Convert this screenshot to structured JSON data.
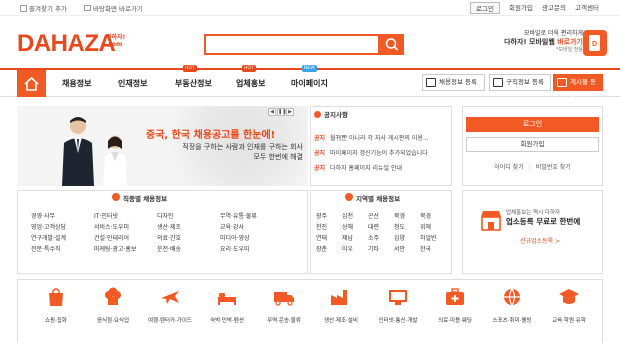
{
  "topbar": {
    "bookmark": "즐겨찾기 추가",
    "desktop": "바탕화면 바로가기",
    "login": "로그인",
    "signup": "회원가입",
    "ad_inquiry": "광고문의",
    "customer_center": "고객센터"
  },
  "header": {
    "logo": "DAHAZA",
    "logo_sub1": "다하자!",
    "logo_sub2": ".com",
    "search_placeholder": "",
    "promo_line1": "모바일로 더욱 편리하게",
    "promo_line2a": "다하자! 모바일웹 ",
    "promo_line2b": "바로가기",
    "promo_line3": "*모바일 전용"
  },
  "nav": {
    "items": [
      {
        "label": "채용정보",
        "badge": ""
      },
      {
        "label": "인재정보",
        "badge": ""
      },
      {
        "label": "부동산정보",
        "badge": "HOT"
      },
      {
        "label": "업체홍보",
        "badge": "HOT"
      },
      {
        "label": "마이페이지",
        "badge": "NEW"
      }
    ],
    "buttons": [
      "채용정보 등록",
      "구직정보 등록",
      "게시물 등록"
    ]
  },
  "banner": {
    "headline": "중국, 한국 채용공고를 한눈에!",
    "sub1": "직장을 구하는 사람과 인재를 구하는 회사",
    "sub2": "모두 한번에 해결"
  },
  "notice": {
    "title": "공지사항",
    "rows": [
      {
        "tag": "공지",
        "text": "월刊뿐 아니라 각 지사 게시판의 이용..."
      },
      {
        "tag": "공지",
        "text": "마이페이지 갱신기능이 추가되었습니다"
      },
      {
        "tag": "공지",
        "text": "다하자 홈페이지 리뉴얼 안내"
      }
    ]
  },
  "login": {
    "login_btn": "로그인",
    "signup_btn": "회원가입",
    "find_id": "아이디 찾기",
    "find_pw": "비밀번호 찾기"
  },
  "job_category": {
    "title": "직종별 채용정보",
    "columns": [
      [
        "경영·사무",
        "영업·고객상담",
        "연구개발·설계",
        "전문·특수직"
      ],
      [
        "IT·인터넷",
        "서비스·도우미",
        "건설·인테리어",
        "마케팅·광고·홍보"
      ],
      [
        "디자인",
        "생산·제조",
        "의료·간호",
        "운전·배송"
      ],
      [
        "무역·유통·물류",
        "교육·강사",
        "미디어·영상",
        "요리·도우미"
      ]
    ]
  },
  "region_category": {
    "title": "지역별 채용정보",
    "columns": [
      [
        "광주",
        "천진",
        "연태",
        "장춘"
      ],
      [
        "심천",
        "상해",
        "제남",
        "이우"
      ],
      [
        "곤산",
        "대련",
        "소주",
        "기타"
      ],
      [
        "북경",
        "청도",
        "심양",
        "서안"
      ],
      [
        "북경",
        "위해",
        "하얼빈",
        "한국"
      ]
    ]
  },
  "ad_box": {
    "line1": "업체홍보는 역시 다하자",
    "line2": "업소등록 무료로 한번에",
    "line3": "신규업소등록 >"
  },
  "bottom_categories": [
    {
      "label": "쇼핑·잡화",
      "icon": "shopping-bag-icon"
    },
    {
      "label": "음식점·요식업",
      "icon": "chef-hat-icon"
    },
    {
      "label": "여행·렌터카·가이드",
      "icon": "airplane-icon"
    },
    {
      "label": "숙박·민박·펜션",
      "icon": "bed-icon"
    },
    {
      "label": "무역·운송·물류",
      "icon": "truck-icon"
    },
    {
      "label": "생산·제조·설비",
      "icon": "factory-icon"
    },
    {
      "label": "인터넷·통신·개발",
      "icon": "monitor-icon"
    },
    {
      "label": "의료·미용·웨딩",
      "icon": "medical-icon"
    },
    {
      "label": "스포츠·취미·웰빙",
      "icon": "sports-icon"
    },
    {
      "label": "교육·학원·유학",
      "icon": "graduation-icon"
    }
  ],
  "colors": {
    "accent": "#f15a24",
    "brand": "#e8481c"
  }
}
